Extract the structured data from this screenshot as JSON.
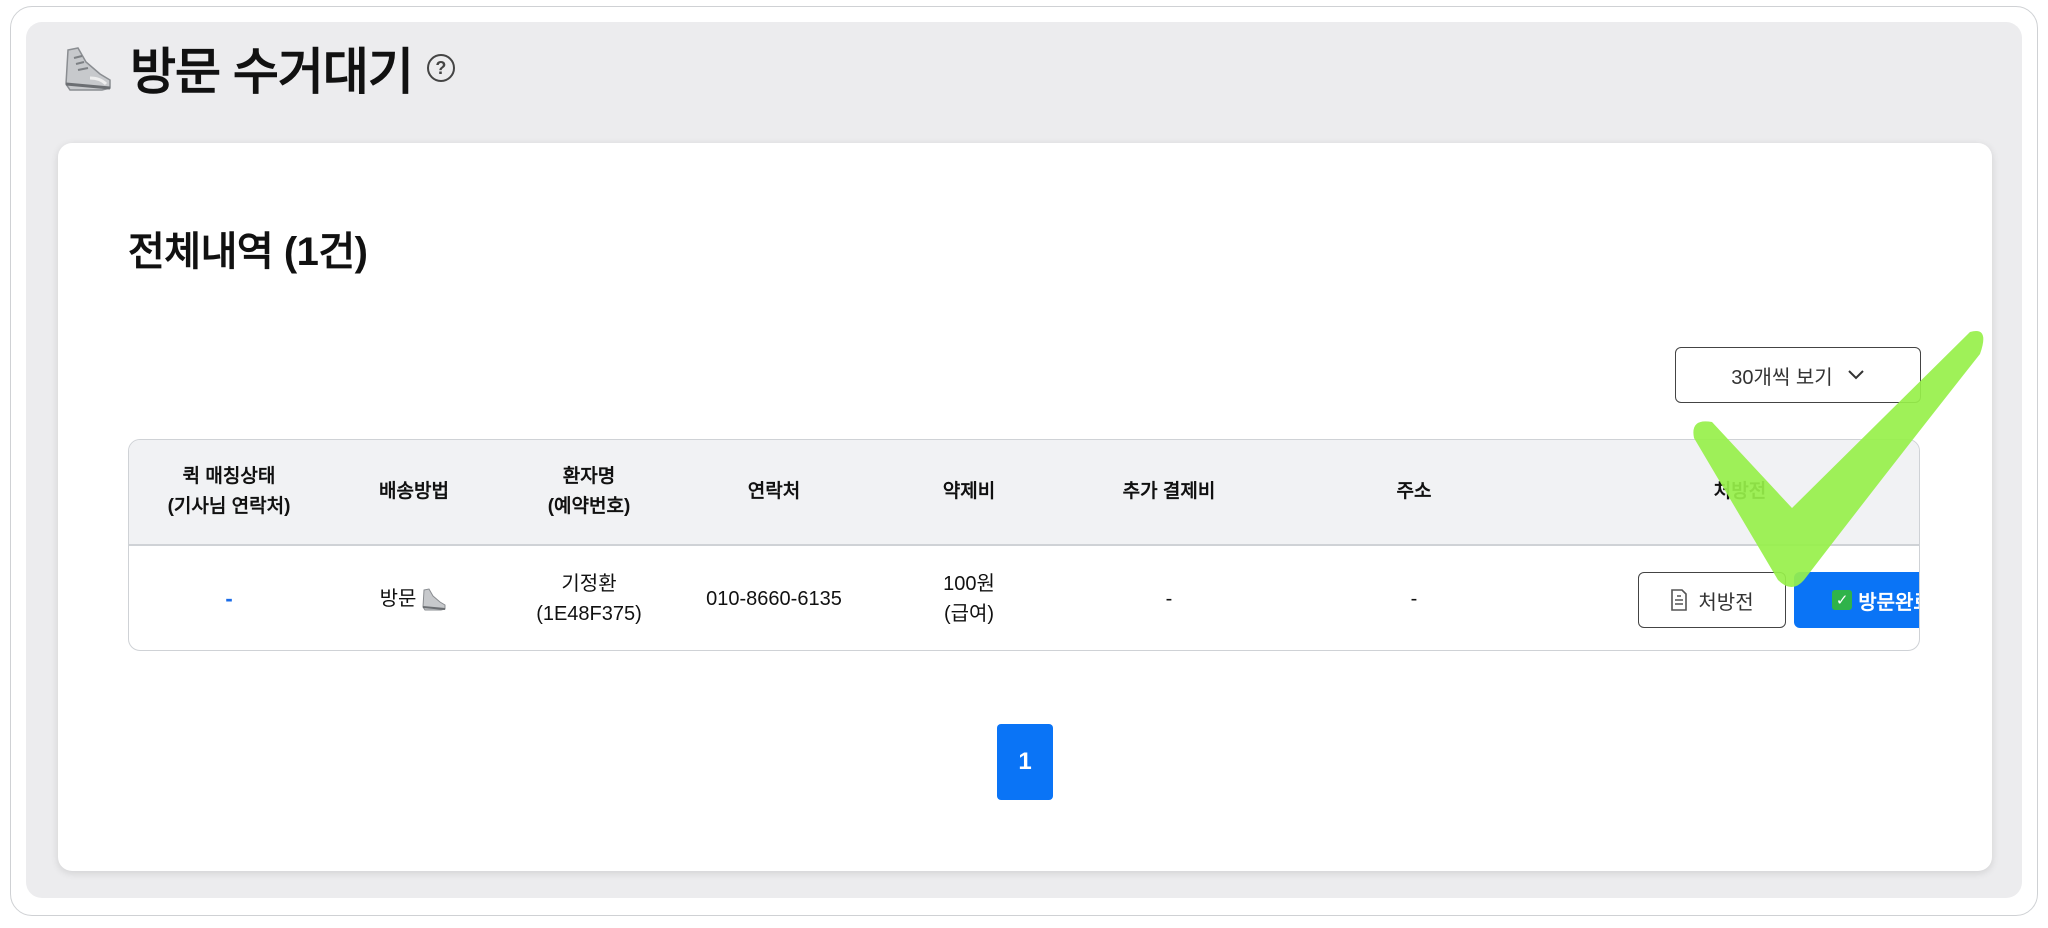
{
  "header": {
    "title": "방문 수거대기",
    "icon": "sneaker-icon",
    "help_icon": "?"
  },
  "section": {
    "title": "전체내역 (1건)"
  },
  "page_size": {
    "label": "30개씩 보기",
    "icon": "chevron-down-icon"
  },
  "table": {
    "columns": [
      "퀵 매칭상태\n(기사님 연락처)",
      "배송방법",
      "환자명\n(예약번호)",
      "연락처",
      "약제비",
      "추가 결제비",
      "주소",
      "처방전"
    ],
    "rows": [
      {
        "quick_status": "-",
        "delivery_method": "방문",
        "delivery_icon": "sneaker-icon",
        "patient": "기정환\n(1E48F375)",
        "phone": "010-8660-6135",
        "medicine_fee": "100원\n(급여)",
        "extra_fee": "-",
        "address": "-",
        "rx_button": "처방전",
        "visit_done_button": "방문완료"
      }
    ]
  },
  "pagination": {
    "current": "1"
  },
  "colors": {
    "primary": "#0a74f6",
    "check_mark": "#97f04a",
    "header_bg": "#f1f2f4"
  }
}
